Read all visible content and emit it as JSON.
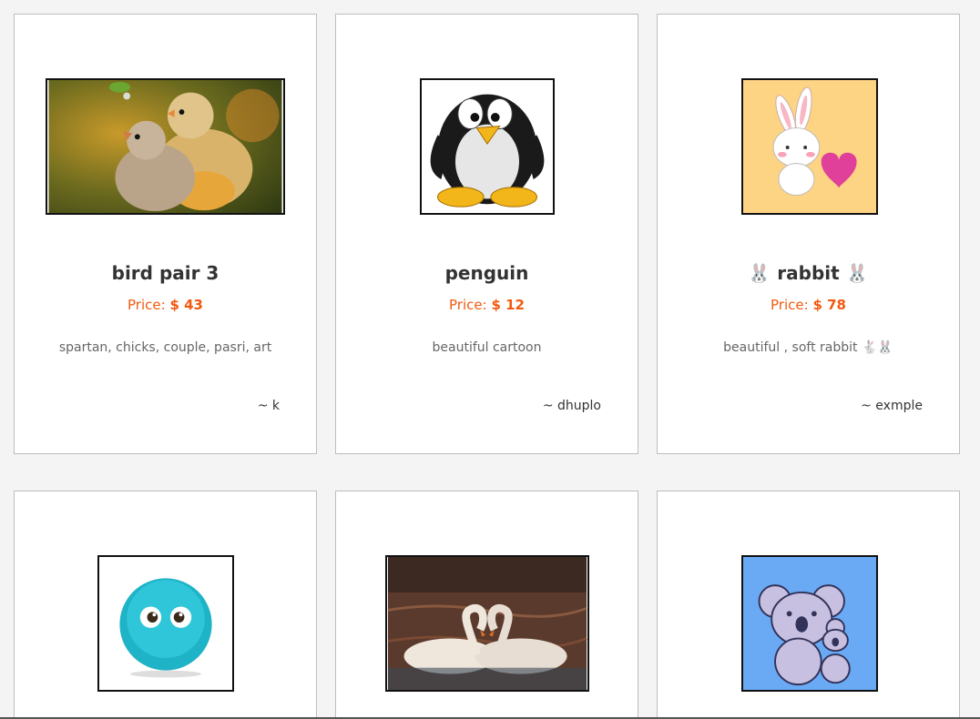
{
  "cards": [
    {
      "title": "bird pair 3",
      "price_label": "Price:",
      "price_value": "$ 43",
      "description": "spartan, chicks, couple, pasri, art",
      "author": "~ k",
      "image_icon": "chicks-photo"
    },
    {
      "title": "penguin",
      "price_label": "Price:",
      "price_value": "$ 12",
      "description": "beautiful cartoon",
      "author": "~ dhuplo",
      "image_icon": "penguin-cartoon"
    },
    {
      "title": "🐰 rabbit 🐰",
      "price_label": "Price:",
      "price_value": "$ 78",
      "description": "beautiful , soft rabbit 🐇🐰",
      "author": "~ exmple",
      "image_icon": "rabbit-heart-cartoon"
    },
    {
      "image_icon": "fluffy-blue-creature"
    },
    {
      "image_icon": "swans-heart-photo"
    },
    {
      "image_icon": "koala-cartoon"
    }
  ],
  "colors": {
    "price": "#f25a10",
    "title": "#333333",
    "description": "#666666",
    "card_border": "#bdbdbd"
  }
}
